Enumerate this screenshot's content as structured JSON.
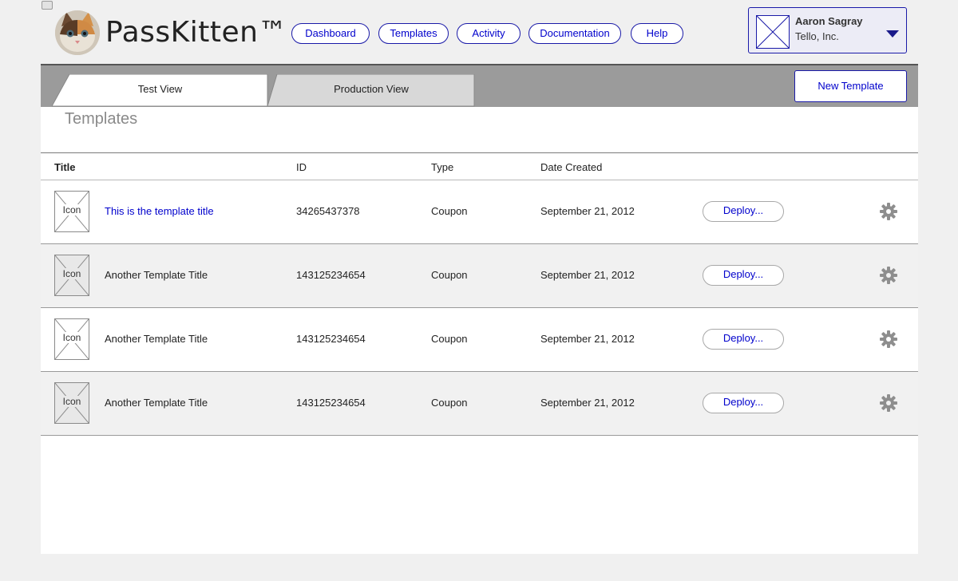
{
  "app": {
    "logo_text": "PassKitten™"
  },
  "nav": [
    {
      "label": "Dashboard"
    },
    {
      "label": "Templates"
    },
    {
      "label": "Activity"
    },
    {
      "label": "Documentation"
    },
    {
      "label": "Help"
    }
  ],
  "user": {
    "name": "Aaron Sagray",
    "org": "Tello, Inc."
  },
  "tabs": [
    {
      "label": "Test View",
      "active": true
    },
    {
      "label": "Production View",
      "active": false
    }
  ],
  "new_template_label": "New Template",
  "section_title": "Templates",
  "table": {
    "headers": {
      "title": "Title",
      "id": "ID",
      "type": "Type",
      "date": "Date Created"
    },
    "rows": [
      {
        "icon": "Icon",
        "title": "This is the template title",
        "title_is_link": true,
        "id": "34265437378",
        "type": "Coupon",
        "date": "September 21, 2012",
        "deploy": "Deploy..."
      },
      {
        "icon": "Icon",
        "title": "Another Template Title",
        "title_is_link": false,
        "id": "143125234654",
        "type": "Coupon",
        "date": "September 21, 2012",
        "deploy": "Deploy..."
      },
      {
        "icon": "Icon",
        "title": "Another Template Title",
        "title_is_link": false,
        "id": "143125234654",
        "type": "Coupon",
        "date": "September 21, 2012",
        "deploy": "Deploy..."
      },
      {
        "icon": "Icon",
        "title": "Another Template Title",
        "title_is_link": false,
        "id": "143125234654",
        "type": "Coupon",
        "date": "September 21, 2012",
        "deploy": "Deploy..."
      }
    ]
  },
  "colors": {
    "accent": "#0000cc",
    "border_blue": "#1a1aa8",
    "tabbar": "#9b9b9b",
    "page_bg": "#f0f0f0"
  },
  "icons": {
    "row_settings": "gear-icon",
    "user_menu": "caret-down-icon",
    "placeholder": "image-placeholder-icon"
  }
}
